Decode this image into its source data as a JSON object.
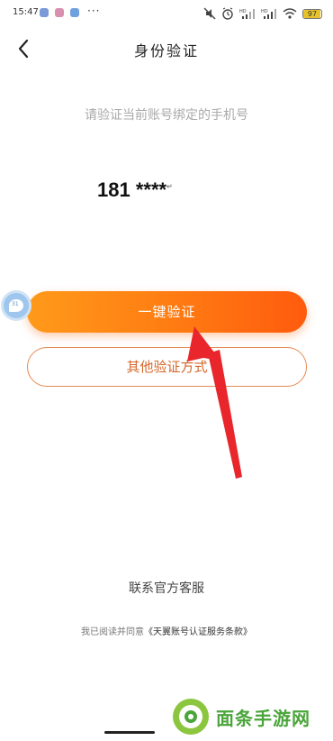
{
  "status_bar": {
    "time": "15:47",
    "dots": "···",
    "battery_level": "97",
    "icons": [
      "notification-app-icon",
      "notification-app-icon",
      "notification-app-icon",
      "mute-icon",
      "alarm-icon",
      "signal-hd-icon",
      "signal-hd-icon",
      "wifi-icon",
      "battery-icon"
    ]
  },
  "nav": {
    "back_icon": "chevron-left-icon",
    "title": "身份验证"
  },
  "main": {
    "subtitle": "请验证当前账号绑定的手机号",
    "phone_number": "181 ****",
    "primary_button": "一键验证",
    "secondary_button": "其他验证方式"
  },
  "footer": {
    "contact": "联系官方客服",
    "agreement_prefix": "我已阅读并同意",
    "agreement_link": "《天翼账号认证服务条款》"
  },
  "floating_bubble": {
    "badge": "31"
  },
  "watermark": {
    "text": "面条手游网"
  },
  "colors": {
    "accent_start": "#ff9a1a",
    "accent_end": "#ff5b0e",
    "secondary_border": "#e48a52",
    "annotation_arrow": "#e8262b",
    "watermark_green": "#4aa53a"
  }
}
